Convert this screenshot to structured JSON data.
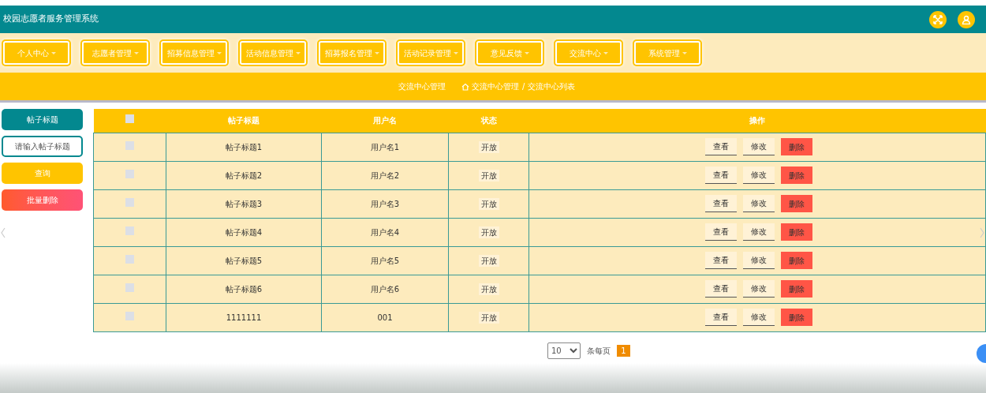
{
  "header": {
    "title": "校园志愿者服务管理系统"
  },
  "nav": [
    {
      "label": "个人中心"
    },
    {
      "label": "志愿者管理"
    },
    {
      "label": "招募信息管理"
    },
    {
      "label": "活动信息管理"
    },
    {
      "label": "招募报名管理"
    },
    {
      "label": "活动记录管理"
    },
    {
      "label": "意见反馈"
    },
    {
      "label": "交流中心"
    },
    {
      "label": "系统管理"
    }
  ],
  "breadcrumb": {
    "title": "交流中心管理",
    "path": [
      "交流中心管理",
      "交流中心列表"
    ],
    "separator": "/"
  },
  "search": {
    "label": "帖子标题",
    "placeholder": "请输入帖子标题",
    "query_button": "查询",
    "batch_delete_button": "批量删除"
  },
  "table": {
    "header_checked": false,
    "columns": [
      "帖子标题",
      "用户名",
      "状态",
      "操作"
    ],
    "rows": [
      {
        "checked": false,
        "title": "帖子标题1",
        "user": "用户名1",
        "status": "开放",
        "actions": [
          "查看",
          "修改",
          "删除"
        ]
      },
      {
        "checked": false,
        "title": "帖子标题2",
        "user": "用户名2",
        "status": "开放",
        "actions": [
          "查看",
          "修改",
          "删除"
        ]
      },
      {
        "checked": false,
        "title": "帖子标题3",
        "user": "用户名3",
        "status": "开放",
        "actions": [
          "查看",
          "修改",
          "删除"
        ]
      },
      {
        "checked": false,
        "title": "帖子标题4",
        "user": "用户名4",
        "status": "开放",
        "actions": [
          "查看",
          "修改",
          "删除"
        ]
      },
      {
        "checked": false,
        "title": "帖子标题5",
        "user": "用户名5",
        "status": "开放",
        "actions": [
          "查看",
          "修改",
          "删除"
        ]
      },
      {
        "checked": false,
        "title": "帖子标题6",
        "user": "用户名6",
        "status": "开放",
        "actions": [
          "查看",
          "修改",
          "删除"
        ]
      },
      {
        "checked": false,
        "title": "1111111",
        "user": "001",
        "status": "开放",
        "actions": [
          "查看",
          "修改",
          "删除"
        ]
      }
    ]
  },
  "pagination": {
    "page_size": "10",
    "per_page_label": "条每页",
    "pages": [
      {
        "label": "1",
        "selected": true
      }
    ]
  }
}
